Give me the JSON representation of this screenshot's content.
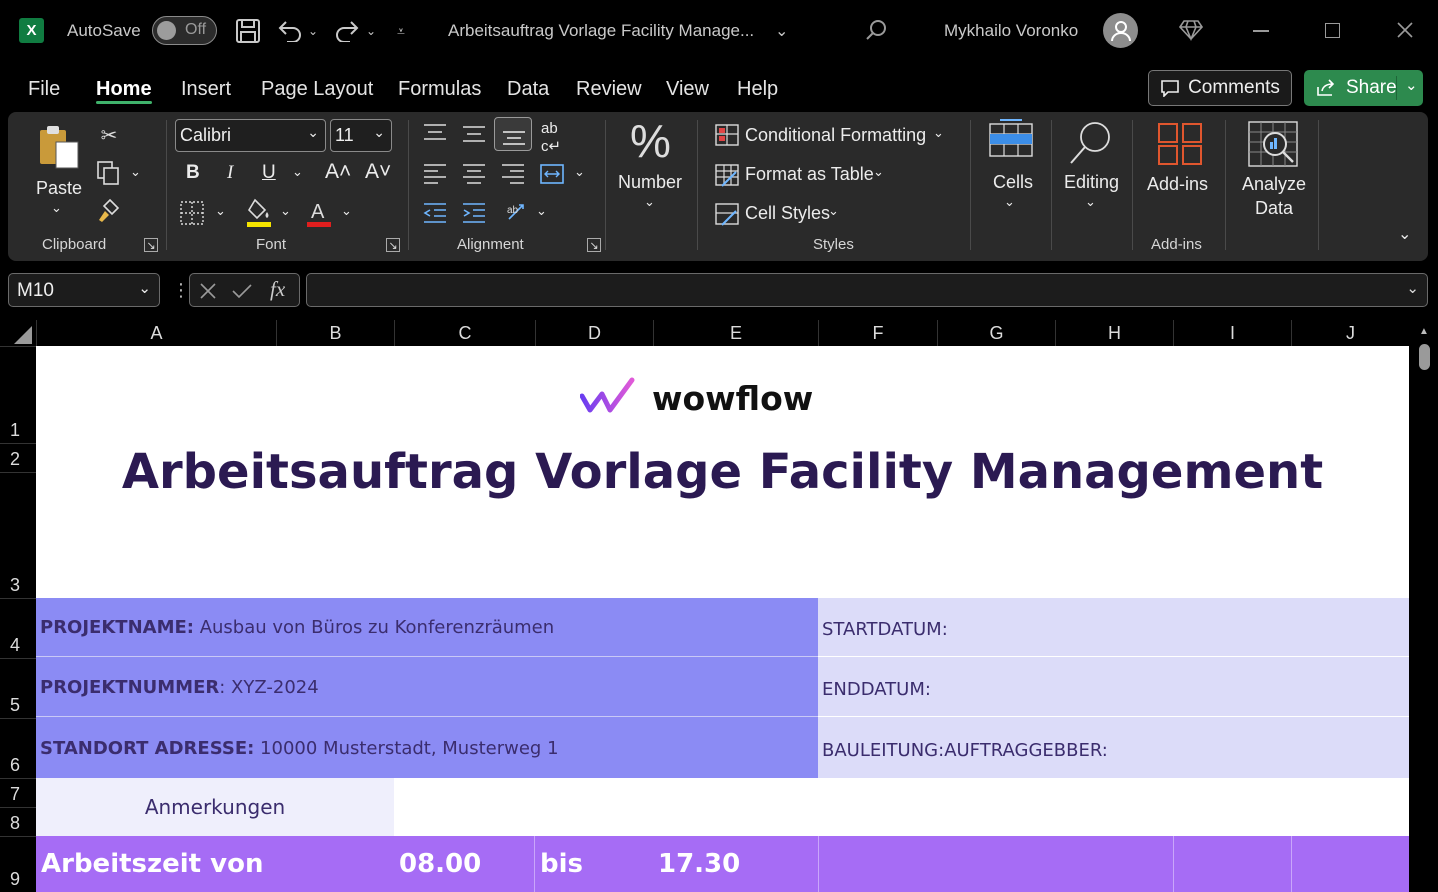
{
  "titlebar": {
    "app_logo": "X",
    "autosave_label": "AutoSave",
    "autosave_state": "Off",
    "doc_title": "Arbeitsauftrag Vorlage Facility Manage...",
    "user_name": "Mykhailo Voronko"
  },
  "menu": {
    "tabs": [
      "File",
      "Home",
      "Insert",
      "Page Layout",
      "Formulas",
      "Data",
      "Review",
      "View",
      "Help"
    ],
    "comments_label": "Comments",
    "share_label": "Share"
  },
  "ribbon": {
    "paste_label": "Paste",
    "clipboard_label": "Clipboard",
    "font_name": "Calibri",
    "font_size": "11",
    "font_label": "Font",
    "bold": "B",
    "italic": "I",
    "underline": "U",
    "alignment_label": "Alignment",
    "number_label": "Number",
    "conditional_formatting": "Conditional Formatting",
    "format_as_table": "Format as Table",
    "cell_styles": "Cell Styles",
    "styles_label": "Styles",
    "cells_label": "Cells",
    "editing_label": "Editing",
    "addins_label": "Add-ins",
    "addins_group_label": "Add-ins",
    "analyze_line1": "Analyze",
    "analyze_line2": "Data",
    "highlight_color": "#f5e400",
    "font_color": "#e01e1e"
  },
  "formula_bar": {
    "name_box": "M10",
    "fx": "fx",
    "value": ""
  },
  "grid": {
    "columns": [
      "A",
      "B",
      "C",
      "D",
      "E",
      "F",
      "G",
      "H",
      "I",
      "J"
    ],
    "rows": [
      "1",
      "2",
      "3",
      "4",
      "5",
      "6",
      "7",
      "8",
      "9"
    ]
  },
  "sheet": {
    "logo_text": "wowflow",
    "title": "Arbeitsauftrag Vorlage Facility Management",
    "projektname_label": "PROJEKTNAME:",
    "projektname_value": " Ausbau von Büros zu Konferenzräumen",
    "projektnummer_label": "PROJEKTNUMMER",
    "projektnummer_value": ": XYZ-2024",
    "standort_label": "STANDORT ADRESSE:",
    "standort_value": " 10000 Musterstadt, Musterweg 1",
    "startdatum": "STARTDATUM:",
    "enddatum": "ENDDATUM:",
    "bauleitung": "BAULEITUNG:AUFTRAGGEBBER:",
    "anmerkungen": "Anmerkungen",
    "arbeitszeit_label": "Arbeitszeit von",
    "arbeitszeit_von": "08.00",
    "bis_label": "bis",
    "arbeitszeit_bis": "17.30"
  },
  "colors": {
    "accent_green": "#2d8a4e",
    "info_left": "#8b8bf4",
    "info_right": "#dcdcf9",
    "anmerkungen_bg": "#efeffc",
    "row9_bg": "#a66cf5",
    "title_color": "#2b1a52"
  }
}
